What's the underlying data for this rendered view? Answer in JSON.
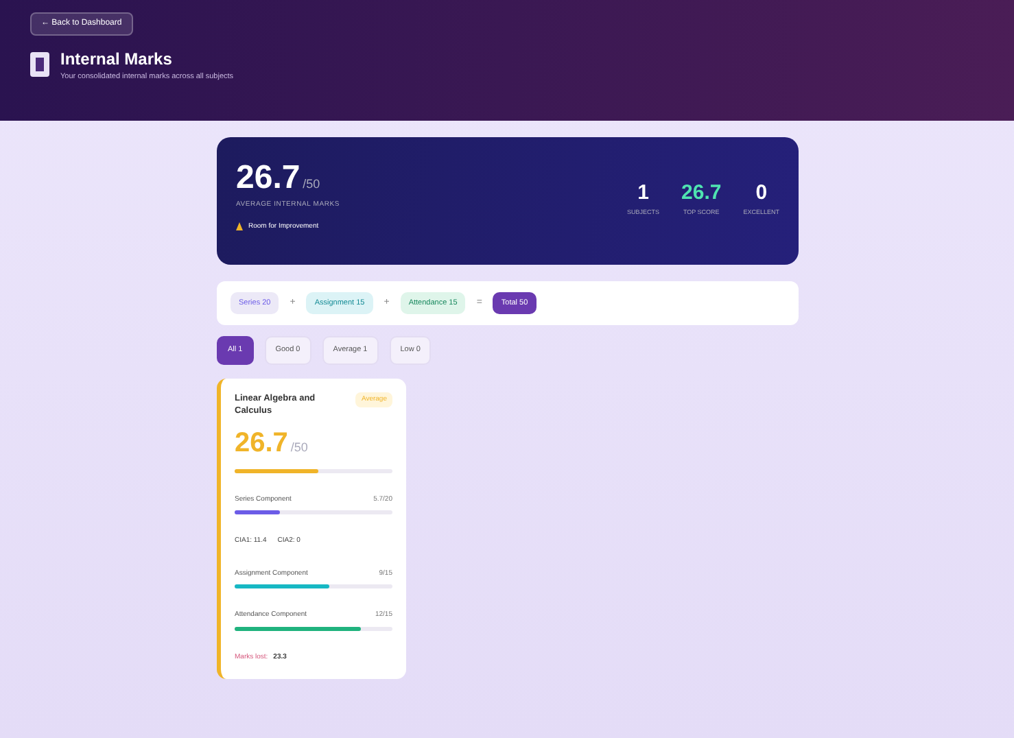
{
  "header": {
    "back_button": "← Back to Dashboard",
    "title": "Internal Marks",
    "subtitle": "Your consolidated internal marks across all subjects"
  },
  "summary": {
    "score": "26.7",
    "out_of": "/50",
    "label": "AVERAGE INTERNAL MARKS",
    "status": "Room for Improvement",
    "stats": [
      {
        "value": "1",
        "label": "SUBJECTS",
        "kind": "plain"
      },
      {
        "value": "26.7",
        "label": "TOP SCORE",
        "kind": "accent"
      },
      {
        "value": "0",
        "label": "EXCELLENT",
        "kind": "plain"
      }
    ]
  },
  "formula": [
    {
      "text": "Series 20",
      "kind": "series"
    },
    {
      "text": "+",
      "kind": "op"
    },
    {
      "text": "Assignment 15",
      "kind": "assignment"
    },
    {
      "text": "+",
      "kind": "op"
    },
    {
      "text": "Attendance 15",
      "kind": "attendance"
    },
    {
      "text": "=",
      "kind": "op"
    },
    {
      "text": "Total 50",
      "kind": "total"
    }
  ],
  "filters": [
    {
      "label": "All",
      "count": "1",
      "selected": true
    },
    {
      "label": "Good",
      "count": "0",
      "selected": false
    },
    {
      "label": "Average",
      "count": "1",
      "selected": false
    },
    {
      "label": "Low",
      "count": "0",
      "selected": false
    }
  ],
  "subjects": [
    {
      "name": "Linear Algebra and Calculus",
      "badge": "Average",
      "color": "#f0b429",
      "score": "26.7",
      "out_of": "/50",
      "level": 0.534,
      "components": [
        {
          "kind": "series",
          "label": "Series Component",
          "value": "5.7/20",
          "level": 0.29,
          "color": "#6c5ce7"
        },
        {
          "kind": "detail",
          "items": [
            "CIA1: 11.4",
            "CIA2: 0"
          ]
        },
        {
          "kind": "assignment",
          "label": "Assignment Component",
          "value": "9/15",
          "level": 0.6,
          "color": "#17b8c4"
        },
        {
          "kind": "attendance",
          "label": "Attendance Component",
          "value": "12/15",
          "level": 0.8,
          "color": "#20b37e"
        }
      ],
      "footer_label": "Marks lost:",
      "footer_value": "23.3"
    }
  ]
}
